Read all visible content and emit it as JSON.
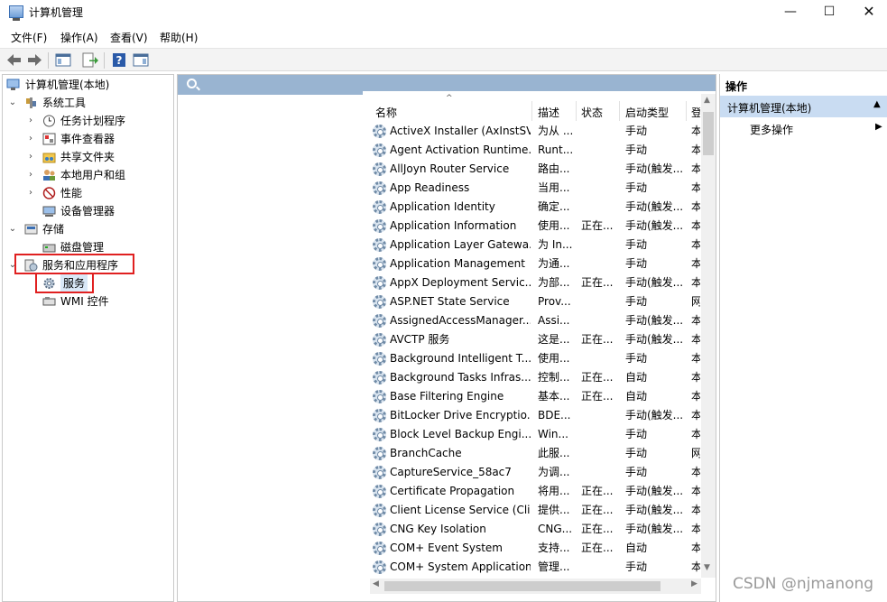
{
  "window": {
    "title": "计算机管理",
    "minimize": "—",
    "maximize": "☐",
    "close": "✕"
  },
  "menu": [
    "文件(F)",
    "操作(A)",
    "查看(V)",
    "帮助(H)"
  ],
  "toolbar": {
    "buttons": [
      "back-icon",
      "forward-icon",
      "show-hide-tree-icon",
      "export-list-icon",
      "help-icon",
      "show-hide-action-pane-icon"
    ]
  },
  "tree": {
    "root": "计算机管理(本地)",
    "system_tools": "系统工具",
    "task_scheduler": "任务计划程序",
    "event_viewer": "事件查看器",
    "shared_folders": "共享文件夹",
    "local_users": "本地用户和组",
    "performance": "性能",
    "device_manager": "设备管理器",
    "storage": "存储",
    "disk_management": "磁盘管理",
    "services_apps": "服务和应用程序",
    "services": "服务",
    "wmi": "WMI 控件"
  },
  "list": {
    "columns": [
      "名称",
      "描述",
      "状态",
      "启动类型",
      "登"
    ],
    "rows": [
      [
        "ActiveX Installer (AxInstSV)",
        "为从 ...",
        "",
        "手动",
        "本"
      ],
      [
        "Agent Activation Runtime...",
        "Runt...",
        "",
        "手动",
        "本"
      ],
      [
        "AllJoyn Router Service",
        "路由...",
        "",
        "手动(触发...",
        "本"
      ],
      [
        "App Readiness",
        "当用...",
        "",
        "手动",
        "本"
      ],
      [
        "Application Identity",
        "确定...",
        "",
        "手动(触发...",
        "本"
      ],
      [
        "Application Information",
        "使用...",
        "正在...",
        "手动(触发...",
        "本"
      ],
      [
        "Application Layer Gatewa...",
        "为 In...",
        "",
        "手动",
        "本"
      ],
      [
        "Application Management",
        "为通...",
        "",
        "手动",
        "本"
      ],
      [
        "AppX Deployment Servic...",
        "为部...",
        "正在...",
        "手动(触发...",
        "本"
      ],
      [
        "ASP.NET State Service",
        "Prov...",
        "",
        "手动",
        "网"
      ],
      [
        "AssignedAccessManager...",
        "Assi...",
        "",
        "手动(触发...",
        "本"
      ],
      [
        "AVCTP 服务",
        "这是...",
        "正在...",
        "手动(触发...",
        "本"
      ],
      [
        "Background Intelligent T...",
        "使用...",
        "",
        "手动",
        "本"
      ],
      [
        "Background Tasks Infras...",
        "控制...",
        "正在...",
        "自动",
        "本"
      ],
      [
        "Base Filtering Engine",
        "基本...",
        "正在...",
        "自动",
        "本"
      ],
      [
        "BitLocker Drive Encryptio...",
        "BDE...",
        "",
        "手动(触发...",
        "本"
      ],
      [
        "Block Level Backup Engi...",
        "Win...",
        "",
        "手动",
        "本"
      ],
      [
        "BranchCache",
        "此服...",
        "",
        "手动",
        "网"
      ],
      [
        "CaptureService_58ac7",
        "为调...",
        "",
        "手动",
        "本"
      ],
      [
        "Certificate Propagation",
        "将用...",
        "正在...",
        "手动(触发...",
        "本"
      ],
      [
        "Client License Service (Cli...",
        "提供...",
        "正在...",
        "手动(触发...",
        "本"
      ],
      [
        "CNG Key Isolation",
        "CNG...",
        "正在...",
        "手动(触发...",
        "本"
      ],
      [
        "COM+ Event System",
        "支持...",
        "正在...",
        "自动",
        "本"
      ],
      [
        "COM+ System Application",
        "管理...",
        "",
        "手动",
        "本"
      ]
    ]
  },
  "actions": {
    "title": "操作",
    "section": "计算机管理(本地)",
    "more": "更多操作"
  },
  "watermark": "CSDN @njmanong"
}
